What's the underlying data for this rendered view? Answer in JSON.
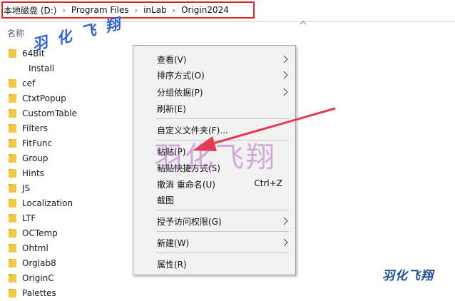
{
  "breadcrumb": {
    "segments": [
      "本地磁盘 (D:)",
      "Program Files",
      "inLab",
      "Origin2024"
    ]
  },
  "list_header": {
    "name_label": "名称"
  },
  "files": [
    "64Bit",
    "Install",
    "cef",
    "CtxtPopup",
    "CustomTable",
    "Filters",
    "FitFunc",
    "Group",
    "Hints",
    "JS",
    "Localization",
    "LTF",
    "OCTemp",
    "Ohtml",
    "Orglab8",
    "OriginC",
    "Palettes"
  ],
  "context_menu": {
    "view": "查看(V)",
    "sort_by": "排序方式(O)",
    "group_by": "分组依据(P)",
    "refresh": "刷新(E)",
    "customize_folder": "自定义文件夹(F)...",
    "paste": "粘贴(P)",
    "paste_shortcut": "粘贴快捷方式(S)",
    "undo_rename": "撤消 重命名(U)",
    "undo_shortcut": "Ctrl+Z",
    "screenshot": "截图",
    "grant_access": "授予访问权限(G)",
    "new": "新建(W)",
    "properties": "属性(R)"
  },
  "watermarks": {
    "top": "羽化飞翔",
    "center": "羽化飞翔",
    "corner": "羽化飞翔"
  },
  "colors": {
    "highlight_box": "#e02828",
    "arrow": "#e8384f",
    "folder": "#f5c842",
    "menu_bg": "#f2f2f2"
  }
}
